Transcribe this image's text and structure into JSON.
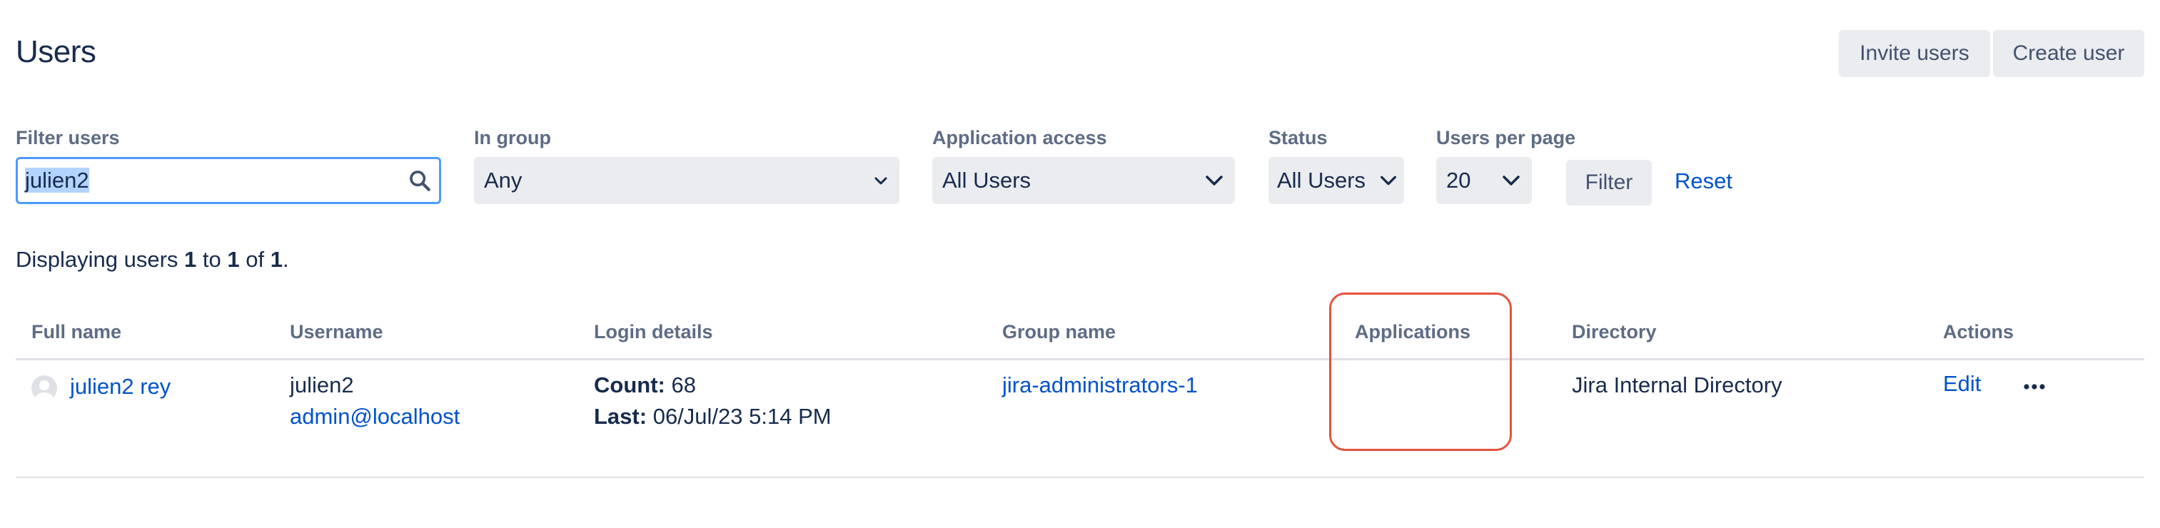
{
  "header": {
    "title": "Users",
    "invite_label": "Invite users",
    "create_label": "Create user"
  },
  "filters": {
    "filter_users": {
      "label": "Filter users",
      "value": "julien2"
    },
    "in_group": {
      "label": "In group",
      "value": "Any"
    },
    "application_access": {
      "label": "Application access",
      "value": "All Users"
    },
    "status": {
      "label": "Status",
      "value": "All Users"
    },
    "per_page": {
      "label": "Users per page",
      "value": "20"
    },
    "filter_button": "Filter",
    "reset_link": "Reset"
  },
  "summary": {
    "prefix": "Displaying users ",
    "from": "1",
    "to_word": " to ",
    "to": "1",
    "of_word": " of ",
    "total": "1",
    "suffix": "."
  },
  "table": {
    "columns": [
      "Full name",
      "Username",
      "Login details",
      "Group name",
      "Applications",
      "Directory",
      "Actions"
    ],
    "rows": [
      {
        "full_name": "julien2 rey",
        "username": "julien2",
        "email": "admin@localhost",
        "count_label": "Count:",
        "count": "68",
        "last_label": "Last:",
        "last": "06/Jul/23 5:14 PM",
        "group": "jira-administrators-1",
        "applications": "",
        "directory": "Jira Internal Directory",
        "edit_label": "Edit"
      }
    ]
  },
  "icons": {
    "search": "search-icon",
    "chevron": "chevron-down-icon",
    "avatar": "avatar",
    "more": "more-icon"
  },
  "colors": {
    "link": "#0052cc",
    "highlight": "#e5533d",
    "focus": "#4c9aff"
  }
}
